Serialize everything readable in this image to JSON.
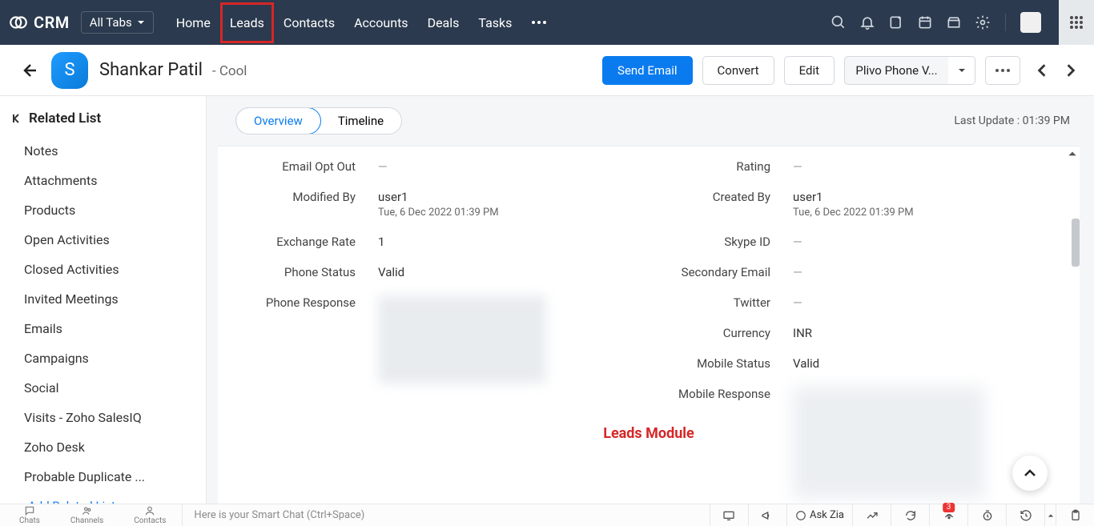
{
  "brand": "CRM",
  "alltabs_label": "All Tabs",
  "nav": {
    "home": "Home",
    "leads": "Leads",
    "contacts": "Contacts",
    "accounts": "Accounts",
    "deals": "Deals",
    "tasks": "Tasks"
  },
  "header": {
    "avatar_letter": "S",
    "name": "Shankar Patil",
    "subtitle": "- Cool",
    "send_email": "Send Email",
    "convert": "Convert",
    "edit": "Edit",
    "phone_action": "Plivo Phone V..."
  },
  "tabs": {
    "overview": "Overview",
    "timeline": "Timeline"
  },
  "last_update": "Last Update : 01:39 PM",
  "sidebar": {
    "title": "Related List",
    "items": [
      "Notes",
      "Attachments",
      "Products",
      "Open Activities",
      "Closed Activities",
      "Invited Meetings",
      "Emails",
      "Campaigns",
      "Social",
      "Visits - Zoho SalesIQ",
      "Zoho Desk",
      "Probable Duplicate ..."
    ],
    "add": "Add Related List"
  },
  "fields_left": {
    "email_opt_out": {
      "label": "Email Opt Out",
      "value": "—"
    },
    "modified_by": {
      "label": "Modified By",
      "value": "user1",
      "sub": "Tue, 6 Dec 2022 01:39 PM"
    },
    "exchange_rate": {
      "label": "Exchange Rate",
      "value": "1"
    },
    "phone_status": {
      "label": "Phone Status",
      "value": "Valid"
    },
    "phone_response": {
      "label": "Phone Response",
      "value": ""
    }
  },
  "fields_right": {
    "rating": {
      "label": "Rating",
      "value": "—"
    },
    "created_by": {
      "label": "Created By",
      "value": "user1",
      "sub": "Tue, 6 Dec 2022 01:39 PM"
    },
    "skype_id": {
      "label": "Skype ID",
      "value": "—"
    },
    "secondary_email": {
      "label": "Secondary Email",
      "value": "—"
    },
    "twitter": {
      "label": "Twitter",
      "value": "—"
    },
    "currency": {
      "label": "Currency",
      "value": "INR"
    },
    "mobile_status": {
      "label": "Mobile Status",
      "value": "Valid"
    },
    "mobile_response": {
      "label": "Mobile Response",
      "value": ""
    }
  },
  "annotation": "Leads Module",
  "bottom": {
    "chats": "Chats",
    "channels": "Channels",
    "contacts": "Contacts",
    "smartchat": "Here is your Smart Chat (Ctrl+Space)",
    "askzia": "Ask Zia",
    "notif_count": "3"
  }
}
